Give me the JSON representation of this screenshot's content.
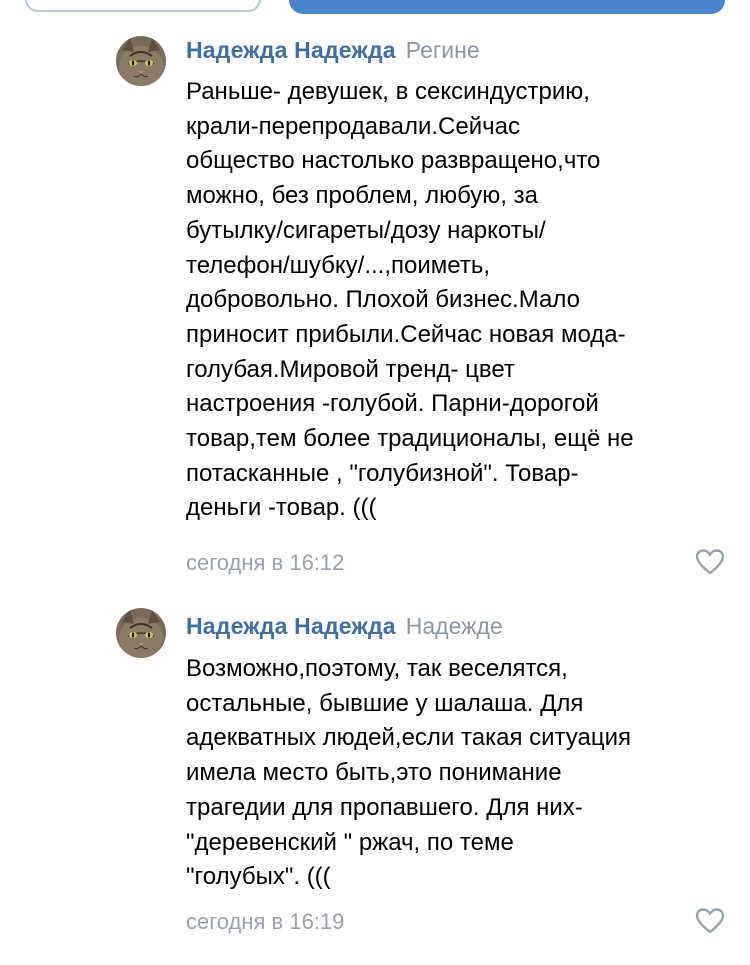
{
  "comments": [
    {
      "author": "Надежда Надежда",
      "reply_to": "Регине",
      "text": "Раньше- девушек, в сексиндустрию,\nкрали-перепродавали.Сейчас\nобщество настолько развращено,что\nможно, без проблем, любую, за\nбутылку/сигареты/дозу наркоты/\nтелефон/шубку/...,поиметь,\nдобровольно. Плохой бизнес.Мало\nприносит прибыли.Сейчас новая мода-\nголубая.Мировой тренд- цвет\nнастроения -голубой. Парни-дорогой\nтовар,тем более традиционалы, ещё не\nпотасканные , \"голубизной\". Товар-\nденьги -товар. (((",
      "time": "сегодня в 16:12"
    },
    {
      "author": "Надежда Надежда",
      "reply_to": "Надежде",
      "text": "Возможно,поэтому, так веселятся,\nостальные, бывшие у шалаша. Для\nадекватных людей,если такая ситуация\nимела место быть,это понимание\nтрагедии для пропавшего. Для них-\n\"деревенский \" ржач, по теме\n\"голубых\". (((",
      "time": "сегодня в 16:19"
    }
  ],
  "colors": {
    "author": "#3f6fa3",
    "meta": "#9aa3ad",
    "accent_button": "#4a86d0"
  },
  "icons": {
    "avatar": "cat-avatar-icon",
    "like": "heart-outline-icon"
  }
}
